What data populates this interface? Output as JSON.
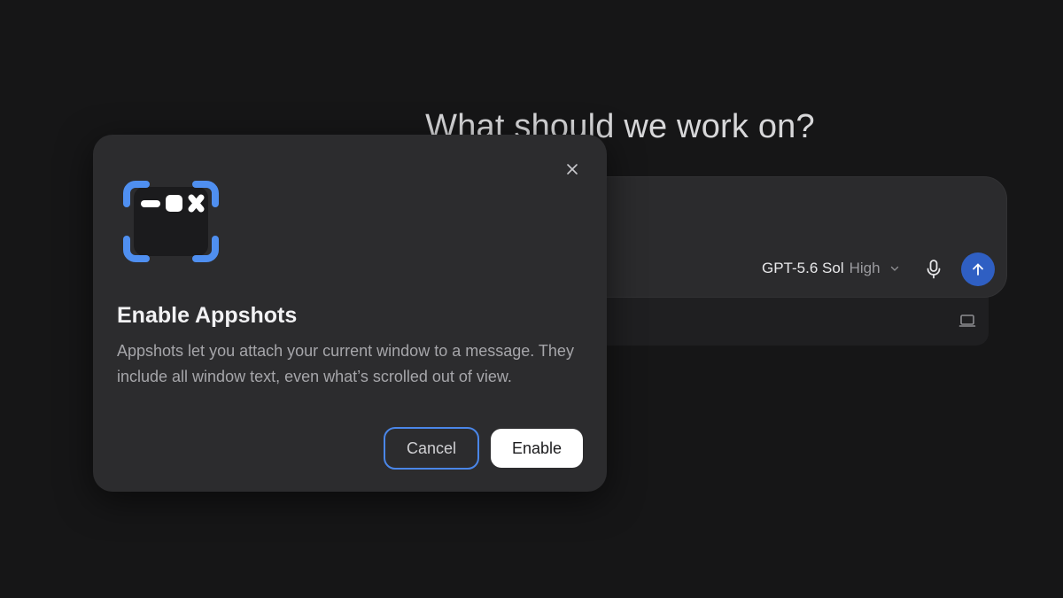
{
  "main": {
    "heading": "What should we work on?"
  },
  "composer": {
    "model_name": "GPT-5.6 Sol",
    "model_effort": "High"
  },
  "dialog": {
    "title": "Enable Appshots",
    "body": "Appshots let you attach your current window to a message. They include all window text, even what’s scrolled out of view.",
    "cancel_label": "Cancel",
    "enable_label": "Enable"
  },
  "colors": {
    "background": "#161617",
    "dialog_bg": "#2c2c2e",
    "accent_blue": "#4a86e8",
    "send_button": "#2f5fc3"
  },
  "icons": {
    "app_icon": "appshots-icon",
    "close": "close-icon",
    "mic": "microphone-icon",
    "send": "arrow-up-icon",
    "dropdown": "chevron-down-icon",
    "laptop": "laptop-icon"
  }
}
